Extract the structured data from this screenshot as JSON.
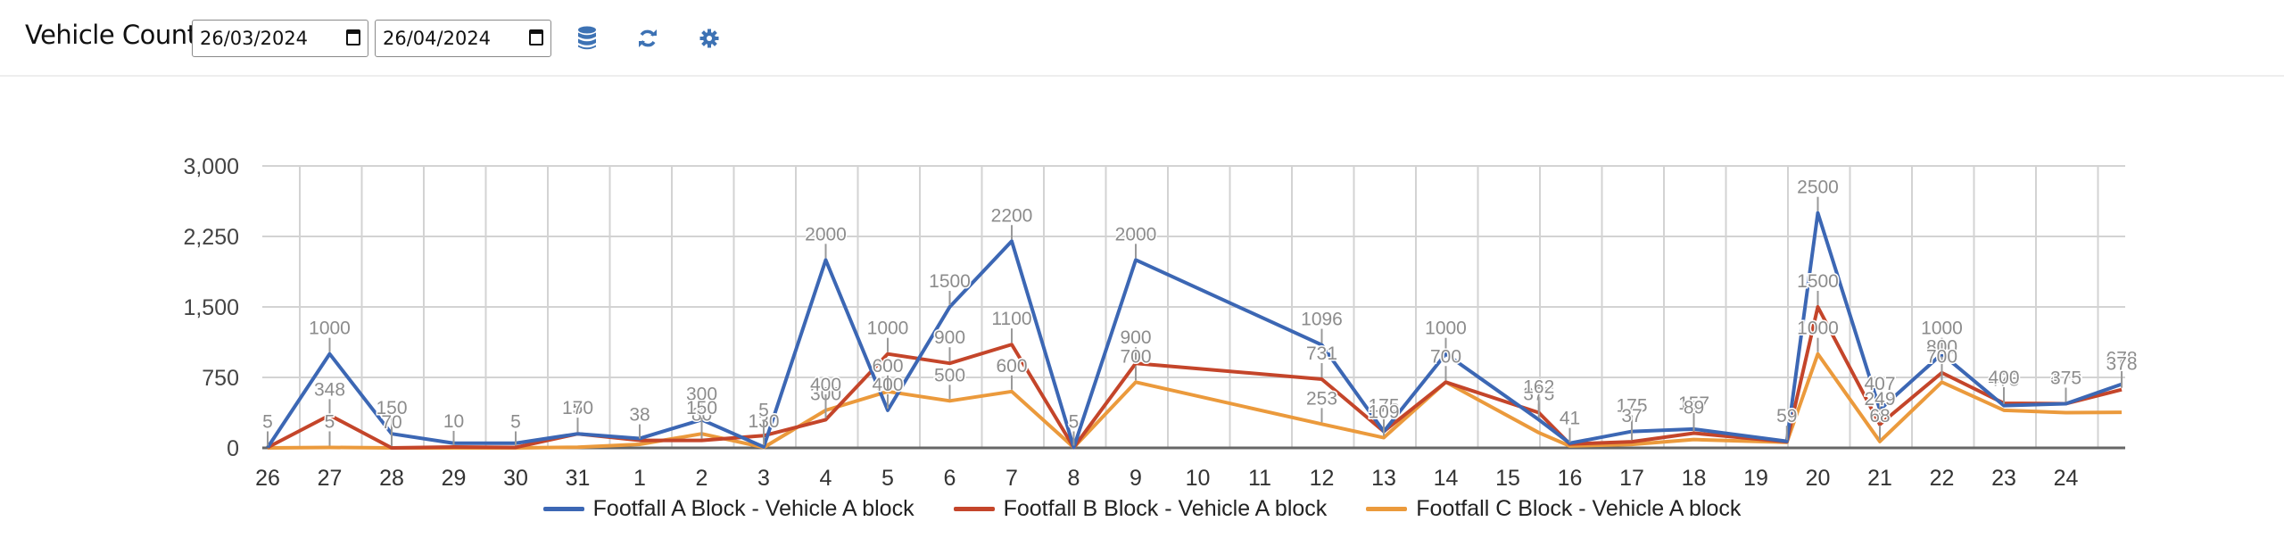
{
  "header": {
    "title": "Vehicle Count",
    "start_date": "26/03/2024",
    "end_date": "26/04/2024",
    "icons": [
      "database-icon",
      "refresh-icon",
      "gear-icon"
    ],
    "icon_color": "#3d72b4"
  },
  "chart_data": {
    "type": "line",
    "title": "",
    "xlabel": "",
    "ylabel": "",
    "ylim": [
      0,
      3000
    ],
    "yticks": [
      "0",
      "750",
      "1,500",
      "2,250",
      "3,000"
    ],
    "ytick_values": [
      0,
      750,
      1500,
      2250,
      3000
    ],
    "grid": true,
    "legend_position": "bottom",
    "categories": [
      "26",
      "27",
      "28",
      "29",
      "30",
      "31",
      "1",
      "2",
      "3",
      "4",
      "5",
      "6",
      "7",
      "8",
      "9",
      "10",
      "11",
      "12",
      "13",
      "14",
      "15",
      "16",
      "17",
      "18",
      "19",
      "20",
      "21",
      "22",
      "23",
      "24"
    ],
    "x": [
      0,
      1,
      2,
      3,
      4,
      5,
      6,
      7,
      8,
      9,
      10,
      11,
      12,
      13,
      14,
      17,
      18,
      19,
      20.5,
      21,
      22,
      23,
      24.5,
      25,
      26,
      27,
      28,
      29,
      29.9
    ],
    "series": [
      {
        "name": "Footfall A Block - Vehicle A block",
        "color": "#3c67b4",
        "values": [
          5,
          1000,
          150,
          50,
          50,
          150,
          100,
          300,
          10,
          2000,
          400,
          1500,
          2200,
          5,
          2000,
          1096,
          175,
          1000,
          300,
          50,
          175,
          200,
          70,
          2500,
          407,
          1000,
          450,
          470,
          678
        ],
        "labels": [
          "5",
          "1000",
          "150",
          "",
          "",
          "150",
          "",
          "300",
          "130",
          "2000",
          "400",
          "1500",
          "2200",
          "5",
          "2000",
          "1096",
          "175",
          "1000",
          "375",
          "",
          "175",
          "157",
          "",
          "2500",
          "407",
          "1000",
          "475",
          "470",
          "678"
        ]
      },
      {
        "name": "Footfall B Block - Vehicle A block",
        "color": "#c4452a",
        "values": [
          5,
          348,
          0,
          10,
          5,
          150,
          80,
          80,
          130,
          300,
          1000,
          900,
          1100,
          5,
          900,
          731,
          175,
          700,
          375,
          41,
          65,
          157,
          65,
          1500,
          249,
          800,
          475,
          470,
          620
        ],
        "labels": [
          "",
          "348",
          "70",
          "10",
          "5",
          "7",
          "38",
          "80",
          "5",
          "300",
          "1000",
          "900",
          "1100",
          "",
          "900",
          "731",
          "",
          "700",
          "162",
          "41",
          "37",
          "89",
          "59",
          "1500",
          "249",
          "800",
          "400",
          "375",
          "378"
        ]
      },
      {
        "name": "Footfall C Block - Vehicle A block",
        "color": "#eb9a3c",
        "values": [
          0,
          5,
          0,
          0,
          0,
          7,
          38,
          150,
          5,
          400,
          600,
          500,
          600,
          5,
          700,
          253,
          109,
          700,
          162,
          20,
          37,
          89,
          59,
          1000,
          68,
          700,
          400,
          375,
          378
        ],
        "labels": [
          "",
          "5",
          "",
          "",
          "",
          "",
          "",
          "150",
          "",
          "400",
          "600",
          "500",
          "600",
          "",
          "700",
          "253",
          "109",
          "",
          "",
          "",
          "",
          "",
          "",
          "1000",
          "68",
          "700",
          "",
          "",
          ""
        ]
      }
    ]
  }
}
